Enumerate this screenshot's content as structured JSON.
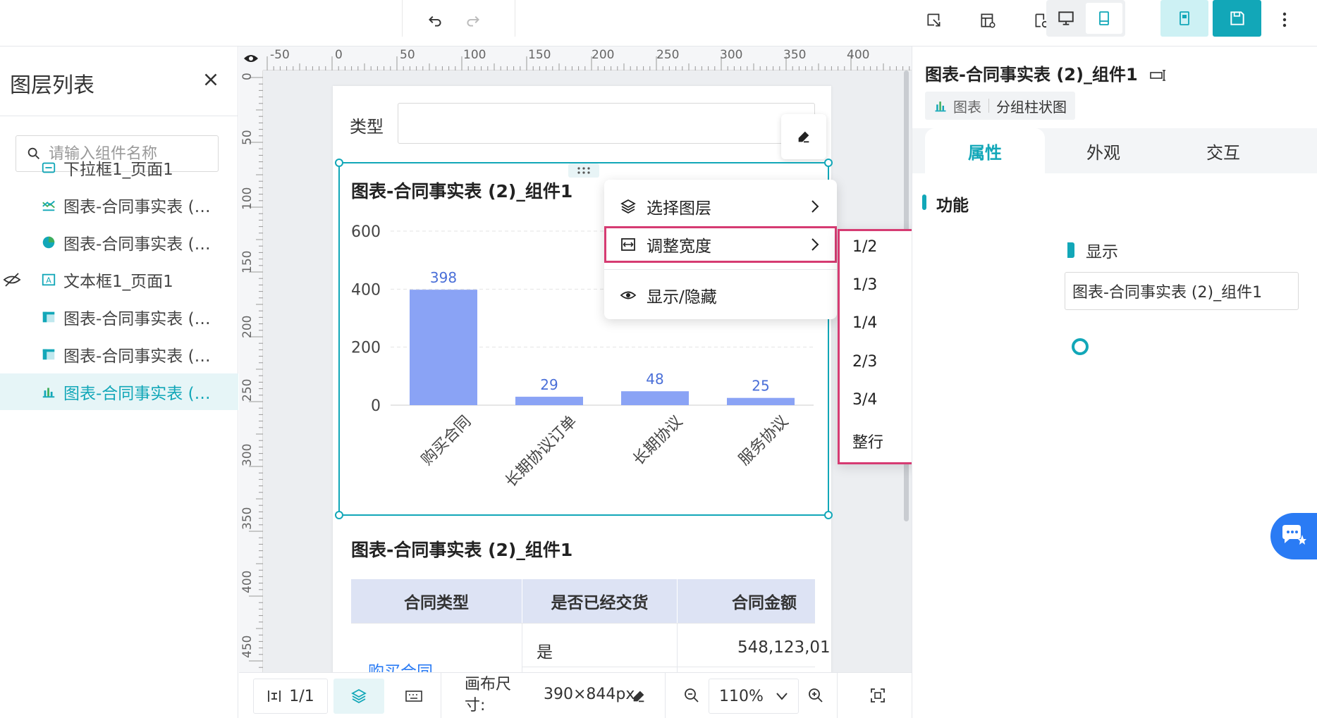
{
  "toolbar": {
    "icons": [
      "undo-icon",
      "redo-icon",
      "preview-icon",
      "template-icon",
      "settings-icon",
      "desktop-icon",
      "mobile-icon",
      "save-draft-icon",
      "save-icon",
      "more-icon"
    ],
    "colors": {
      "accent": "#12a7b8",
      "accent_light": "#cdf1f4"
    }
  },
  "left_panel": {
    "title": "图层列表",
    "search_placeholder": "请输入组件名称",
    "items": [
      {
        "label": "下拉框1_页面1",
        "icon": "dropdown-icon"
      },
      {
        "label": "图表-合同事实表 (…",
        "icon": "line-chart-icon"
      },
      {
        "label": "图表-合同事实表 (…",
        "icon": "pie-chart-icon"
      },
      {
        "label": "文本框1_页面1",
        "icon": "textbox-icon",
        "hidden": true
      },
      {
        "label": "图表-合同事实表 (…",
        "icon": "table-icon"
      },
      {
        "label": "图表-合同事实表 (…",
        "icon": "table-icon"
      },
      {
        "label": "图表-合同事实表 (…",
        "icon": "bar-chart-icon",
        "active": true
      }
    ]
  },
  "ruler": {
    "top": [
      "-50",
      "0",
      "50",
      "100",
      "150",
      "200",
      "250",
      "300",
      "350",
      "400"
    ],
    "left": [
      "0",
      "50",
      "100",
      "150",
      "200",
      "250",
      "300",
      "350",
      "400",
      "450"
    ]
  },
  "canvas": {
    "filter_label": "类型",
    "chart_title": "图表-合同事实表 (2)_组件1",
    "table_title": "图表-合同事实表 (2)_组件1",
    "table": {
      "headers": [
        "合同类型",
        "是否已经交货",
        "合同金额"
      ],
      "row1": {
        "type": "购买合同",
        "delivered": "是",
        "amount": "548,123,01"
      }
    }
  },
  "chart_data": {
    "type": "bar",
    "categories": [
      "购买合同",
      "长期协议订单",
      "长期协议",
      "服务协议"
    ],
    "values": [
      398,
      29,
      48,
      25
    ],
    "y_ticks": [
      "0",
      "200",
      "400",
      "600"
    ],
    "ylim": [
      0,
      600
    ],
    "bar_color": "#8aa3f5",
    "label_color": "#4a6fd8"
  },
  "context_menu": {
    "items": [
      {
        "label": "选择图层",
        "icon": "layers-icon",
        "has_submenu": true
      },
      {
        "label": "调整宽度",
        "icon": "resize-width-icon",
        "has_submenu": true,
        "highlighted": true
      },
      {
        "label": "显示/隐藏",
        "icon": "eye-icon",
        "has_submenu": false
      }
    ],
    "submenu": [
      "1/2",
      "1/3",
      "1/4",
      "2/3",
      "3/4",
      "整行"
    ]
  },
  "bottom_bar": {
    "page_label": "1/1",
    "canvas_size_label": "画布尺寸:",
    "canvas_size_value": "390×844px",
    "zoom": "110%"
  },
  "right_panel": {
    "title": "图表-合同事实表 (2)_组件1",
    "tag_type": "图表",
    "tag_subtype": "分组柱状图",
    "tabs": [
      "属性",
      "外观",
      "交互"
    ],
    "section_title": "功能",
    "show_label": "显示",
    "name_value": "图表-合同事实表 (2)_组件1"
  }
}
